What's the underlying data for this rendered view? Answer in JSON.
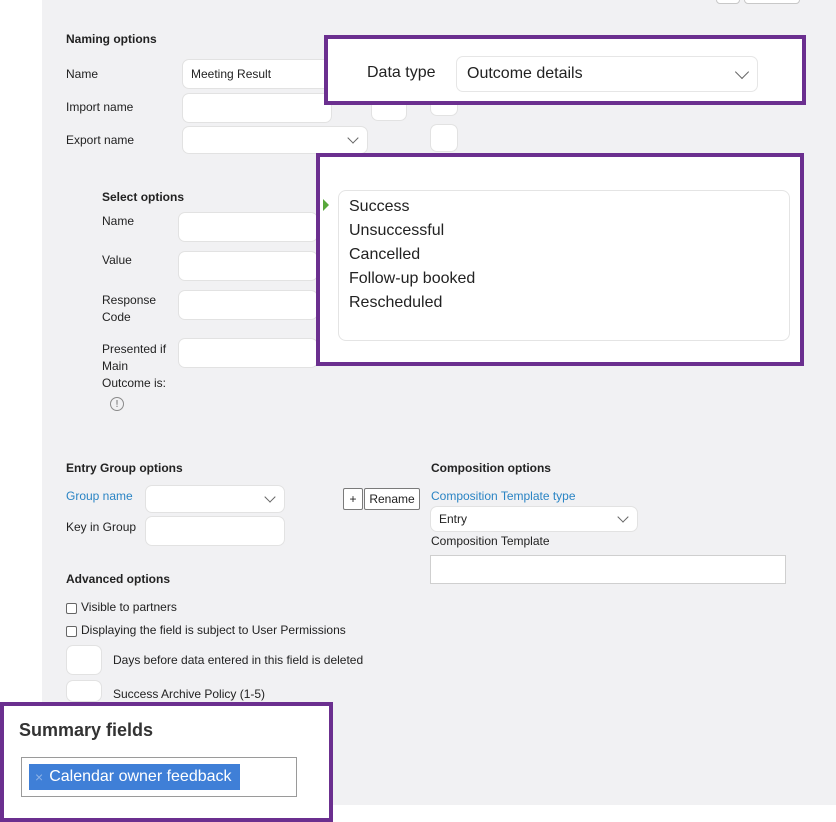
{
  "naming": {
    "title": "Naming options",
    "name_label": "Name",
    "name_value": "Meeting Result",
    "import_label": "Import name",
    "export_label": "Export name"
  },
  "data_type": {
    "label": "Data type",
    "value": "Outcome details"
  },
  "select_options": {
    "title": "Select options",
    "name_label": "Name",
    "value_label": "Value",
    "response_code_label": "Response Code",
    "presented_label": "Presented if Main Outcome is:",
    "options": [
      "Success",
      "Unsuccessful",
      "Cancelled",
      "Follow-up booked",
      "Rescheduled"
    ]
  },
  "entry_group": {
    "title": "Entry Group options",
    "group_name_label": "Group name",
    "key_label": "Key in Group",
    "add_label": "+",
    "rename_label": "Rename"
  },
  "composition": {
    "title": "Composition options",
    "template_type_label": "Composition Template type",
    "template_type_value": "Entry",
    "template_label": "Composition Template"
  },
  "advanced": {
    "title": "Advanced options",
    "visible_partners_label": "Visible to partners",
    "permissions_label": "Displaying the field is subject to User Permissions",
    "days_label": "Days before data entered in this field is deleted",
    "archive_label": "Success Archive Policy (1-5)"
  },
  "summary": {
    "title": "Summary fields",
    "chip_label": "Calendar owner feedback"
  },
  "colors": {
    "accent_purple": "#6b2f8f",
    "link_blue": "#2a84c4",
    "chip_blue": "#3f7fd7",
    "arrow_green": "#58a83b"
  }
}
